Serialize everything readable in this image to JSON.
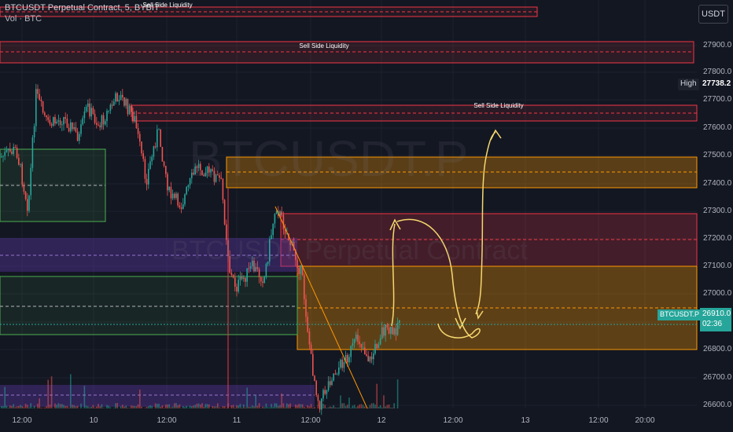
{
  "legend": {
    "symbol": "BTCUSDT Perpetual Contract, 5, BYBIT",
    "volume": "Vol · BTC"
  },
  "currency_button": "USDT",
  "watermark": {
    "ticker": "BTCUSDT.P",
    "description": "BTCUSDT Perpetual Contract"
  },
  "zones": {
    "sell_side_liquidity": "Sell Side Liquidity"
  },
  "y_axis": {
    "ticks": [
      "27900.0",
      "27800.0",
      "27700.0",
      "27600.0",
      "27500.0",
      "27400.0",
      "27300.0",
      "27200.0",
      "27100.0",
      "27000.0",
      "26900.0",
      "26800.0",
      "26700.0",
      "26600.0"
    ]
  },
  "x_axis": {
    "ticks": [
      "12:00",
      "10",
      "12:00",
      "11",
      "12:00",
      "12",
      "12:00",
      "13",
      "12:00",
      "20:00"
    ]
  },
  "high_tag": {
    "label": "High",
    "value": "27738.2"
  },
  "price_tag": {
    "symbol": "BTCUSDT.P",
    "value": "26910.0",
    "countdown": "02:36"
  },
  "colors": {
    "background": "#131722",
    "bull": "#26a69a",
    "bear": "#ef5350",
    "annotation": "#f5d76e",
    "orange_zone": "#ff9800",
    "red_zone": "#f23645",
    "purple_zone": "#673ab7",
    "green_zone": "#4caf50"
  }
}
